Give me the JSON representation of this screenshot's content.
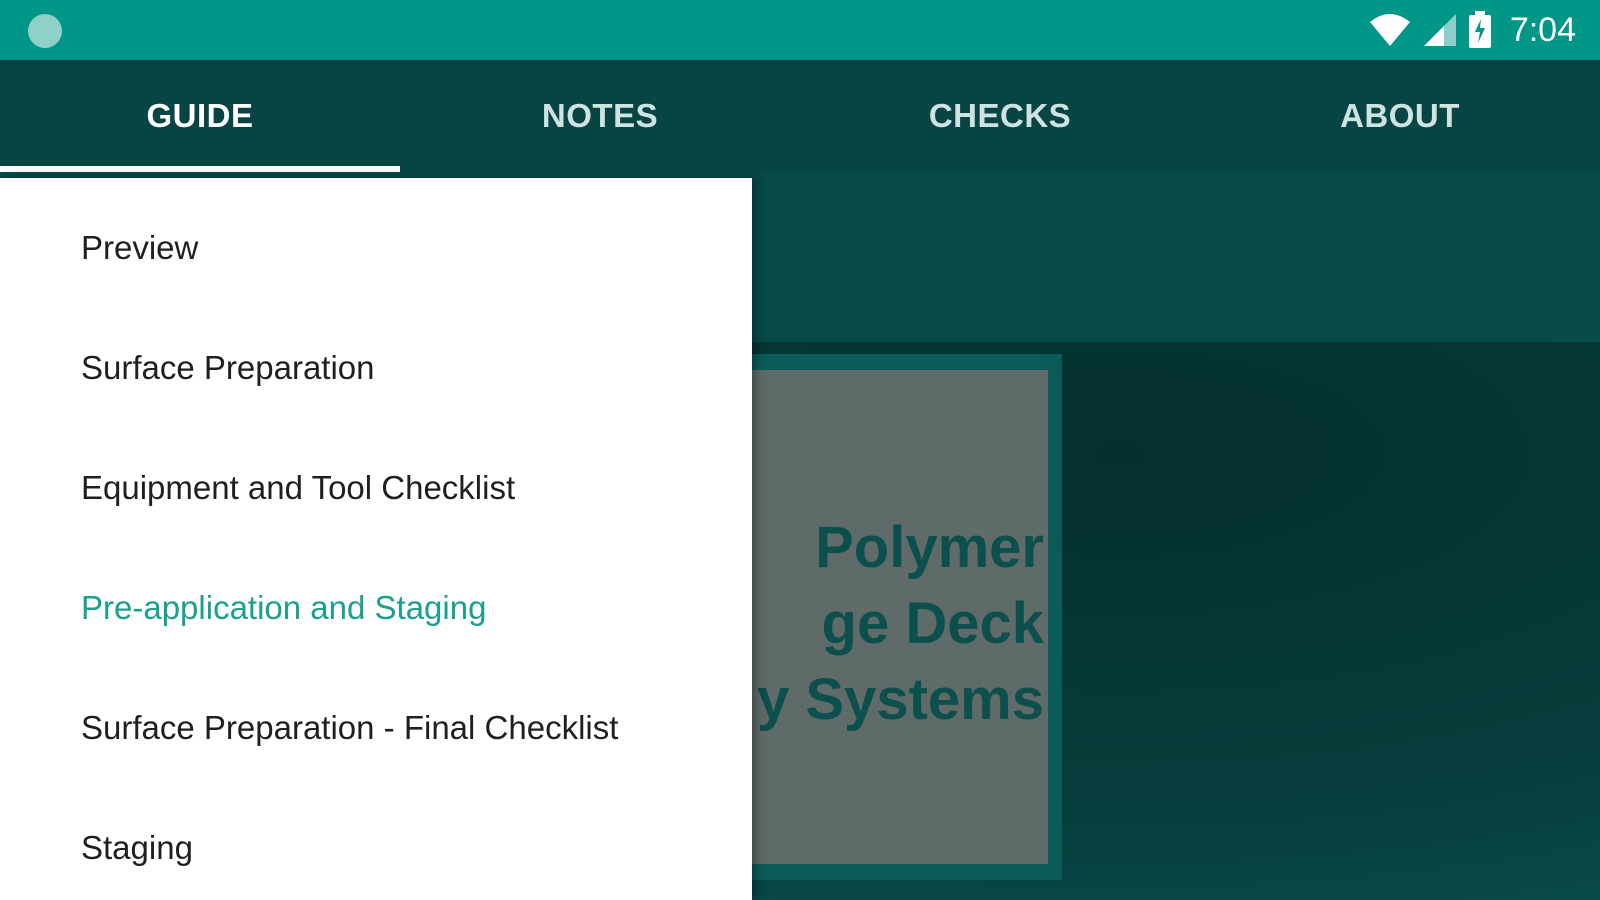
{
  "status_bar": {
    "time": "7:04",
    "icons": [
      "app-notification-icon",
      "wifi-icon",
      "cellular-signal-icon",
      "battery-charging-icon"
    ]
  },
  "tabs": [
    {
      "label": "GUIDE",
      "active": true
    },
    {
      "label": "NOTES",
      "active": false
    },
    {
      "label": "CHECKS",
      "active": false
    },
    {
      "label": "ABOUT",
      "active": false
    }
  ],
  "drawer": {
    "items": [
      {
        "label": "Preview"
      },
      {
        "label": "Surface Preparation"
      },
      {
        "label": "Equipment and Tool Checklist"
      },
      {
        "label": "Pre-application and Staging",
        "selected": true
      },
      {
        "label": "Surface Preparation - Final Checklist"
      },
      {
        "label": "Staging"
      }
    ]
  },
  "cover": {
    "lines": [
      "Polymer",
      "ge Deck",
      "y Systems"
    ]
  },
  "colors": {
    "status_bar": "#009688",
    "app_bar": "#074544",
    "selected_item": "#1aa08f"
  }
}
